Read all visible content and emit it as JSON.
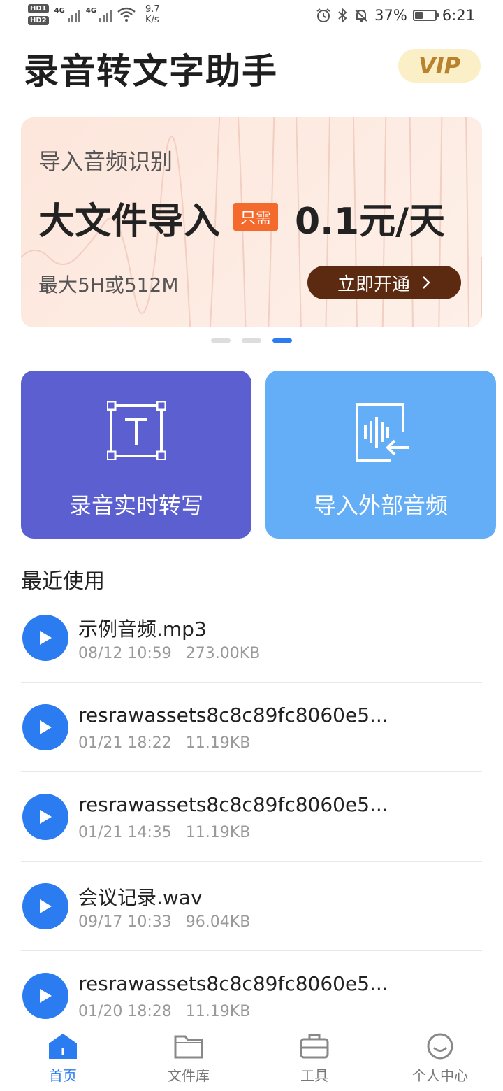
{
  "status": {
    "speed_value": "9.7",
    "speed_unit": "K/s",
    "network1": "4G",
    "network2": "4G",
    "battery": "37%",
    "time": "6:21"
  },
  "header": {
    "title": "录音转文字助手",
    "vip": "VIP"
  },
  "banner": {
    "subtitle": "导入音频识别",
    "main": "大文件导入",
    "tag": "只需",
    "price": "0.1元/天",
    "note": "最大5H或512M",
    "button": "立即开通",
    "active_dot": 3,
    "total_dots": 3
  },
  "features": [
    {
      "label": "录音实时转写",
      "icon": "text-transcribe-icon"
    },
    {
      "label": "导入外部音频",
      "icon": "import-audio-icon"
    }
  ],
  "recent": {
    "title": "最近使用",
    "items": [
      {
        "name": "示例音频.mp3",
        "date": "08/12 10:59",
        "size": "273.00KB"
      },
      {
        "name": "resrawassets8c8c89fc8060e5...",
        "date": "01/21 18:22",
        "size": "11.19KB"
      },
      {
        "name": "resrawassets8c8c89fc8060e5...",
        "date": "01/21 14:35",
        "size": "11.19KB"
      },
      {
        "name": "会议记录.wav",
        "date": "09/17 10:33",
        "size": "96.04KB"
      },
      {
        "name": "resrawassets8c8c89fc8060e5...",
        "date": "01/20 18:28",
        "size": "11.19KB"
      }
    ]
  },
  "nav": [
    {
      "label": "首页",
      "icon": "home-icon",
      "active": true
    },
    {
      "label": "文件库",
      "icon": "folder-icon",
      "active": false
    },
    {
      "label": "工具",
      "icon": "toolbox-icon",
      "active": false
    },
    {
      "label": "个人中心",
      "icon": "smiley-icon",
      "active": false
    }
  ],
  "colors": {
    "primary": "#2b7cf0",
    "card_record": "#5b5fcf",
    "card_import": "#63aef7",
    "banner_button": "#5c2a10",
    "tag": "#f36a2c"
  }
}
